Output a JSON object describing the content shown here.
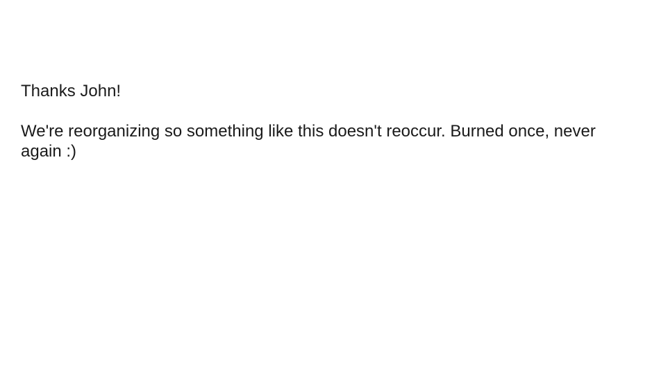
{
  "message": {
    "greeting": "Thanks John!",
    "body": "We're reorganizing so something like this doesn't reoccur. Burned once, never again :)"
  }
}
